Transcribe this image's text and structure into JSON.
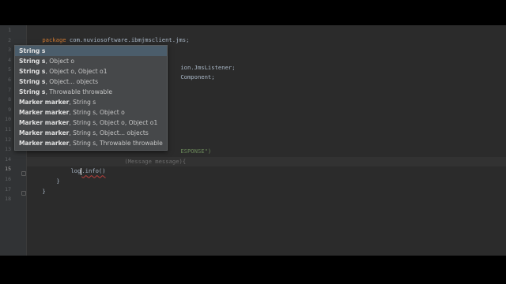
{
  "editor": {
    "line_numbers": [
      "1",
      "2",
      "3",
      "4",
      "5",
      "6",
      "7",
      "8",
      "9",
      "10",
      "11",
      "12",
      "13",
      "14",
      "15",
      "16",
      "17",
      "18"
    ],
    "current_line": "15",
    "lines": {
      "l1": {
        "kw": "package",
        "rest": " com.nuviosoftware.ibmjmsclient.jms;"
      },
      "l3_frag": "ion.JmsListener;",
      "l4_frag": "Component;",
      "l11_frag": "ESPONSE\")",
      "l12_frag": "(Message message){",
      "l15_obj": "log",
      "l15_method": ".info()",
      "l16": "}",
      "l17": "}"
    }
  },
  "autocomplete": {
    "items": [
      {
        "bold": "String s",
        "rest": ""
      },
      {
        "bold": "String s",
        "rest": ", Object o"
      },
      {
        "bold": "String s",
        "rest": ", Object o, Object o1"
      },
      {
        "bold": "String s",
        "rest": ", Object... objects"
      },
      {
        "bold": "String s",
        "rest": ", Throwable throwable"
      },
      {
        "bold": "Marker marker",
        "rest": ", String s"
      },
      {
        "bold": "Marker marker",
        "rest": ", String s, Object o"
      },
      {
        "bold": "Marker marker",
        "rest": ", String s, Object o, Object o1"
      },
      {
        "bold": "Marker marker",
        "rest": ", String s, Object... objects"
      },
      {
        "bold": "Marker marker",
        "rest": ", String s, Throwable throwable"
      }
    ],
    "selected_index": 0
  },
  "colors": {
    "editor_bg": "#2b2b2b",
    "keyword": "#cc7832",
    "string": "#6a8759",
    "annotation": "#bbb529",
    "popup_bg": "#46484a"
  }
}
